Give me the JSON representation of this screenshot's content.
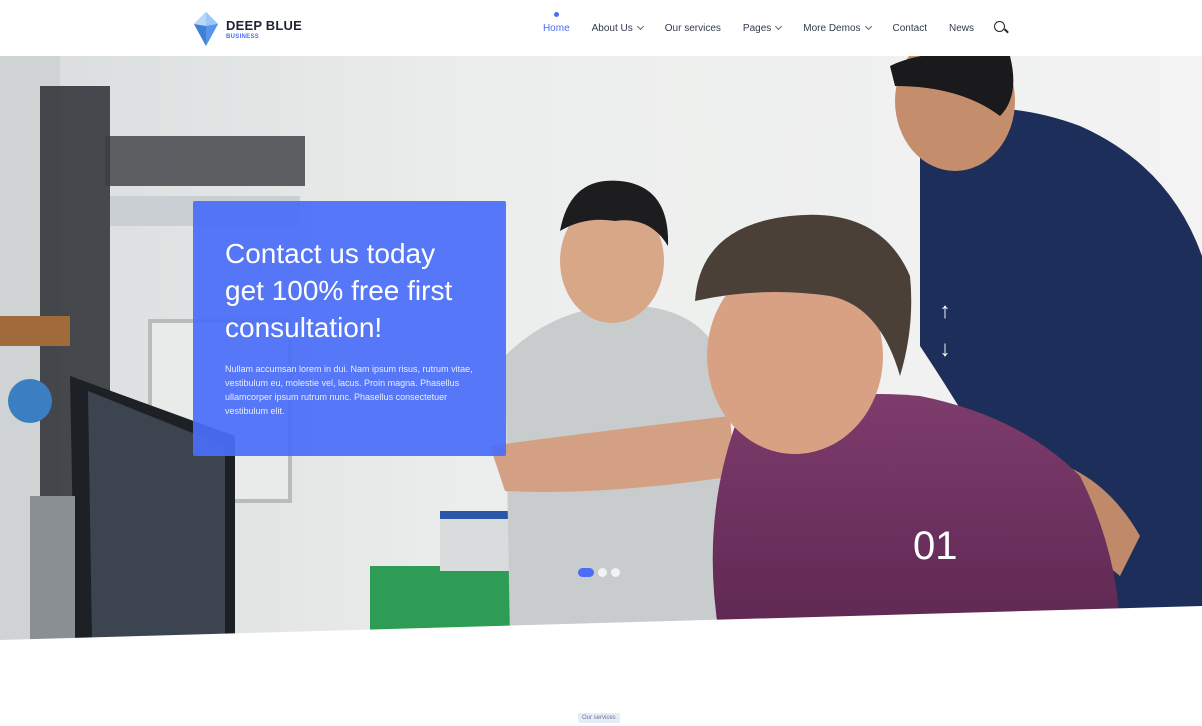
{
  "brand": {
    "title": "DEEP BLUE",
    "subtitle": "BUSINESS"
  },
  "nav": {
    "items": [
      {
        "label": "Home",
        "active": true,
        "dropdown": false
      },
      {
        "label": "About Us",
        "active": false,
        "dropdown": true
      },
      {
        "label": "Our services",
        "active": false,
        "dropdown": false
      },
      {
        "label": "Pages",
        "active": false,
        "dropdown": true
      },
      {
        "label": "More Demos",
        "active": false,
        "dropdown": true
      },
      {
        "label": "Contact",
        "active": false,
        "dropdown": false
      },
      {
        "label": "News",
        "active": false,
        "dropdown": false
      }
    ],
    "search_icon": "search-icon"
  },
  "hero": {
    "title": "Contact us today get 100% free first consultation!",
    "text": "Nullam accumsan lorem in dui. Nam ipsum risus, rutrum vitae, vestibulum eu, molestie vel, lacus. Proin magna. Phasellus ullamcorper ipsum rutrum nunc. Phasellus consectetuer vestibulum elit.",
    "slide_number": "01",
    "arrow_up": "↑",
    "arrow_down": "↓",
    "slides_total": 3,
    "active_slide": 1
  },
  "section": {
    "tag": "Our services"
  },
  "colors": {
    "accent": "#4a6cf7",
    "card": "#4a6ef7",
    "text_dark": "#1f2433"
  }
}
